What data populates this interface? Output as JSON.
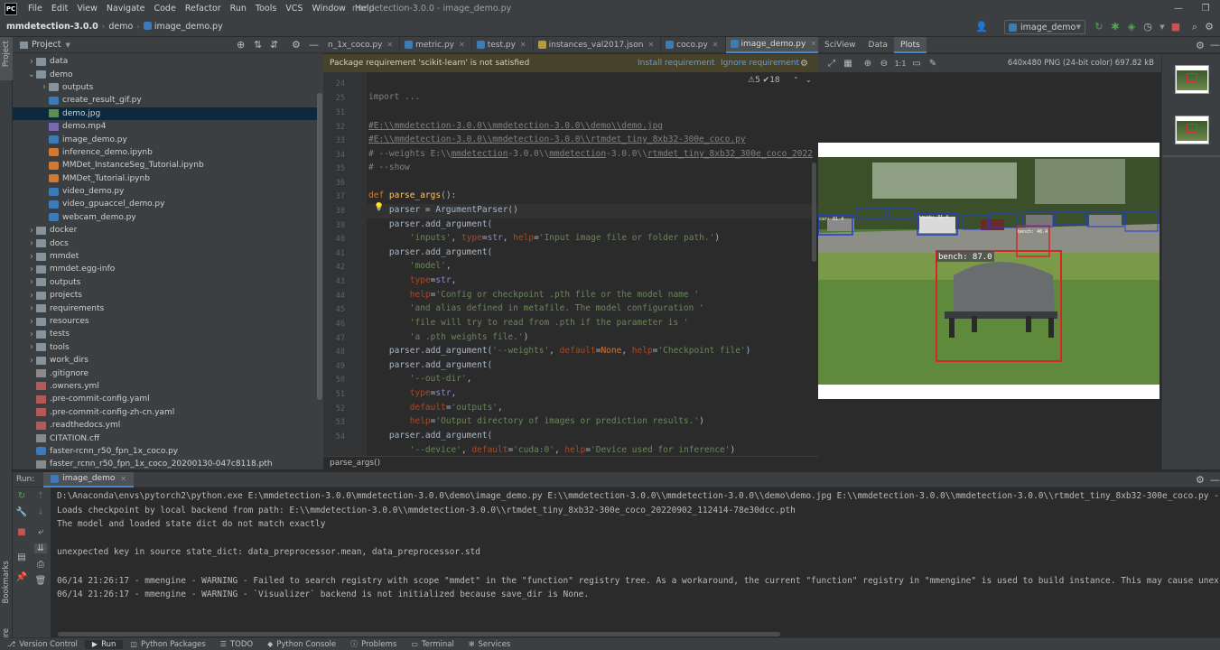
{
  "menu": {
    "logo": "PC",
    "items": [
      "File",
      "Edit",
      "View",
      "Navigate",
      "Code",
      "Refactor",
      "Run",
      "Tools",
      "VCS",
      "Window",
      "Help"
    ],
    "window_title": "mmdetection-3.0.0 - image_demo.py"
  },
  "navbar": {
    "crumbs": [
      "mmdetection-3.0.0",
      "demo",
      "image_demo.py"
    ],
    "run_config": "image_demo"
  },
  "project": {
    "title": "Project",
    "tree": [
      {
        "label": "data",
        "type": "folder",
        "depth": 1,
        "expanded": false
      },
      {
        "label": "demo",
        "type": "folder",
        "depth": 1,
        "expanded": true
      },
      {
        "label": "outputs",
        "type": "folder",
        "depth": 2,
        "expanded": false
      },
      {
        "label": "create_result_gif.py",
        "type": "py",
        "depth": 2
      },
      {
        "label": "demo.jpg",
        "type": "img",
        "depth": 2,
        "selected": true
      },
      {
        "label": "demo.mp4",
        "type": "vid",
        "depth": 2
      },
      {
        "label": "image_demo.py",
        "type": "py",
        "depth": 2
      },
      {
        "label": "inference_demo.ipynb",
        "type": "nb",
        "depth": 2
      },
      {
        "label": "MMDet_InstanceSeg_Tutorial.ipynb",
        "type": "nb",
        "depth": 2
      },
      {
        "label": "MMDet_Tutorial.ipynb",
        "type": "nb",
        "depth": 2
      },
      {
        "label": "video_demo.py",
        "type": "py",
        "depth": 2
      },
      {
        "label": "video_gpuaccel_demo.py",
        "type": "py",
        "depth": 2
      },
      {
        "label": "webcam_demo.py",
        "type": "py",
        "depth": 2
      },
      {
        "label": "docker",
        "type": "folder",
        "depth": 1,
        "expanded": false
      },
      {
        "label": "docs",
        "type": "folder",
        "depth": 1,
        "expanded": false
      },
      {
        "label": "mmdet",
        "type": "folder",
        "depth": 1,
        "expanded": false
      },
      {
        "label": "mmdet.egg-info",
        "type": "folder",
        "depth": 1,
        "expanded": false
      },
      {
        "label": "outputs",
        "type": "folder",
        "depth": 1,
        "expanded": false
      },
      {
        "label": "projects",
        "type": "folder",
        "depth": 1,
        "expanded": false
      },
      {
        "label": "requirements",
        "type": "folder",
        "depth": 1,
        "expanded": false
      },
      {
        "label": "resources",
        "type": "folder",
        "depth": 1,
        "expanded": false
      },
      {
        "label": "tests",
        "type": "folder",
        "depth": 1,
        "expanded": false
      },
      {
        "label": "tools",
        "type": "folder",
        "depth": 1,
        "expanded": false
      },
      {
        "label": "work_dirs",
        "type": "folder",
        "depth": 1,
        "expanded": false
      },
      {
        "label": ".gitignore",
        "type": "gen",
        "depth": 1
      },
      {
        "label": ".owners.yml",
        "type": "cfg",
        "depth": 1
      },
      {
        "label": ".pre-commit-config.yaml",
        "type": "cfg",
        "depth": 1
      },
      {
        "label": ".pre-commit-config-zh-cn.yaml",
        "type": "cfg",
        "depth": 1
      },
      {
        "label": ".readthedocs.yml",
        "type": "cfg",
        "depth": 1
      },
      {
        "label": "CITATION.cff",
        "type": "gen",
        "depth": 1
      },
      {
        "label": "faster-rcnn_r50_fpn_1x_coco.py",
        "type": "py",
        "depth": 1
      },
      {
        "label": "faster_rcnn_r50_fpn_1x_coco_20200130-047c8118.pth",
        "type": "gen",
        "depth": 1
      }
    ]
  },
  "editor": {
    "tabs": [
      {
        "label": "n_1x_coco.py",
        "active": false
      },
      {
        "label": "metric.py",
        "active": false
      },
      {
        "label": "test.py",
        "active": false
      },
      {
        "label": "instances_val2017.json",
        "active": false
      },
      {
        "label": "coco.py",
        "active": false
      },
      {
        "label": "image_demo.py",
        "active": true
      }
    ],
    "banner": {
      "message": "Package requirement 'scikit-learn' is not satisfied",
      "install": "Install requirement",
      "ignore": "Ignore requirement"
    },
    "inspections": "⚠5  ✔18",
    "breadcrumb": "parse_args()",
    "line_numbers": [
      "24",
      "25",
      "31",
      "32",
      "33",
      "34",
      "35",
      "36",
      "37",
      "38",
      "39",
      "40",
      "41",
      "42",
      "43",
      "44",
      "45",
      "46",
      "47",
      "48",
      "49",
      "50",
      "51",
      "52",
      "53",
      "54"
    ]
  },
  "sciview": {
    "title": "SciView",
    "tabs": [
      "Data",
      "Plots"
    ],
    "active_tab": "Plots",
    "zoom": "1:1",
    "info": "640x480 PNG (24-bit color) 697.82 kB",
    "detections": [
      {
        "label": "bench: 87.0",
        "color": "#d62728"
      },
      {
        "label": "bench: 46.4",
        "color": "#d62728"
      },
      {
        "label": "car: 81.4",
        "color": "#1f3fd1"
      },
      {
        "label": "truck: 31.4",
        "color": "#1f3fd1"
      }
    ]
  },
  "run": {
    "label": "Run:",
    "tab": "image_demo",
    "lines": [
      "D:\\Anaconda\\envs\\pytorch2\\python.exe E:\\mmdetection-3.0.0\\mmdetection-3.0.0\\demo\\image_demo.py E:\\\\mmdetection-3.0.0\\\\mmdetection-3.0.0\\\\demo\\demo.jpg E:\\\\mmdetection-3.0.0\\\\mmdetection-3.0.0\\\\rtmdet_tiny_8xb32-300e_coco.py -",
      "Loads checkpoint by local backend from path: E:\\\\mmdetection-3.0.0\\\\mmdetection-3.0.0\\\\rtmdet_tiny_8xb32-300e_coco_20220902_112414-78e30dcc.pth",
      "The model and loaded state dict do not match exactly",
      "",
      "unexpected key in source state_dict: data_preprocessor.mean, data_preprocessor.std",
      "",
      "06/14 21:26:17 - mmengine - WARNING - Failed to search registry with scope \"mmdet\" in the \"function\" registry tree. As a workaround, the current \"function\" registry in \"mmengine\" is used to build instance. This may cause unex",
      "06/14 21:26:17 - mmengine - WARNING - `Visualizer` backend is not initialized because save_dir is None."
    ]
  },
  "bottombar": {
    "items": [
      "Version Control",
      "Run",
      "Python Packages",
      "TODO",
      "Python Console",
      "Problems",
      "Terminal",
      "Services"
    ],
    "active": "Run"
  },
  "side_labels": {
    "project": "Project",
    "bookmarks": "Bookmarks",
    "structure": "Structure"
  }
}
